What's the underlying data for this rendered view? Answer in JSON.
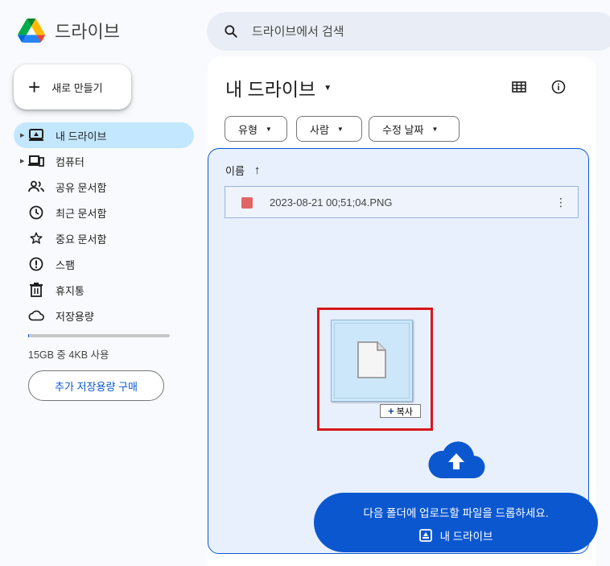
{
  "app": {
    "name": "드라이브"
  },
  "search": {
    "placeholder": "드라이브에서 검색",
    "icon": "search-icon"
  },
  "new_button": {
    "label": "새로 만들기"
  },
  "sidebar": {
    "items": [
      {
        "label": "내 드라이브",
        "icon": "my-drive-icon",
        "active": true,
        "expandable": true
      },
      {
        "label": "컴퓨터",
        "icon": "computer-icon",
        "active": false,
        "expandable": true
      },
      {
        "label": "공유 문서함",
        "icon": "shared-icon",
        "active": false
      },
      {
        "label": "최근 문서함",
        "icon": "clock-icon",
        "active": false
      },
      {
        "label": "중요 문서함",
        "icon": "star-icon",
        "active": false
      },
      {
        "label": "스팸",
        "icon": "spam-icon",
        "active": false
      },
      {
        "label": "휴지통",
        "icon": "trash-icon",
        "active": false
      },
      {
        "label": "저장용량",
        "icon": "cloud-icon",
        "active": false
      }
    ],
    "storage_text": "15GB 중 4KB 사용",
    "storage_fraction": 3e-07,
    "buy_storage_label": "추가 저장용량 구매"
  },
  "main": {
    "title": "내 드라이브",
    "filters": [
      {
        "label": "유형"
      },
      {
        "label": "사람"
      },
      {
        "label": "수정 날짜"
      }
    ],
    "column_header": "이름",
    "files": [
      {
        "name": "2023-08-21 00;51;04.PNG",
        "icon": "image-file-icon"
      }
    ],
    "drag": {
      "copy_label": "복사",
      "copy_symbol": "+"
    },
    "toast": {
      "message": "다음 폴더에 업로드할 파일을 드롭하세요.",
      "folder": "내 드라이브"
    }
  },
  "colors": {
    "accent": "#0b57d0",
    "active_nav": "#c2e7ff",
    "drop_zone": "#e8f0fe",
    "highlight_box": "#d6171b"
  }
}
